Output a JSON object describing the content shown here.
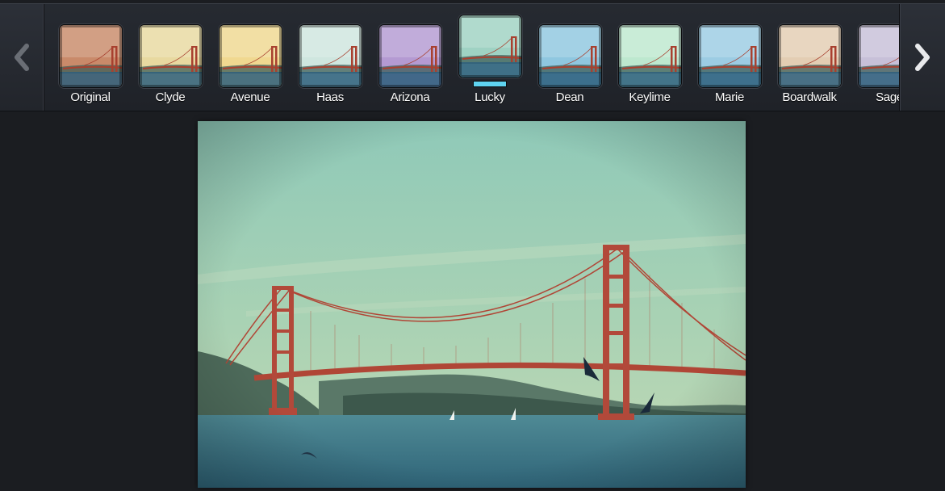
{
  "filter_strip": {
    "prev_icon": "chevron-left-icon",
    "next_icon": "chevron-right-icon",
    "selected": "Lucky",
    "filters": [
      {
        "label": "Original",
        "tint": "#c98a6a"
      },
      {
        "label": "Clyde",
        "tint": "#e8d9a0"
      },
      {
        "label": "Avenue",
        "tint": "#f0d890"
      },
      {
        "label": "Haas",
        "tint": "#cfe6df"
      },
      {
        "label": "Arizona",
        "tint": "#b49ad2"
      },
      {
        "label": "Lucky",
        "tint": "#9fd2c3"
      },
      {
        "label": "Dean",
        "tint": "#8fc7e0"
      },
      {
        "label": "Keylime",
        "tint": "#bde8cf"
      },
      {
        "label": "Marie",
        "tint": "#9ccce3"
      },
      {
        "label": "Boardwalk",
        "tint": "#e3cdb3"
      },
      {
        "label": "Sage",
        "tint": "#c7c0d8"
      }
    ]
  },
  "preview": {
    "subject": "Golden Gate Bridge",
    "filter_applied": "Lucky"
  }
}
